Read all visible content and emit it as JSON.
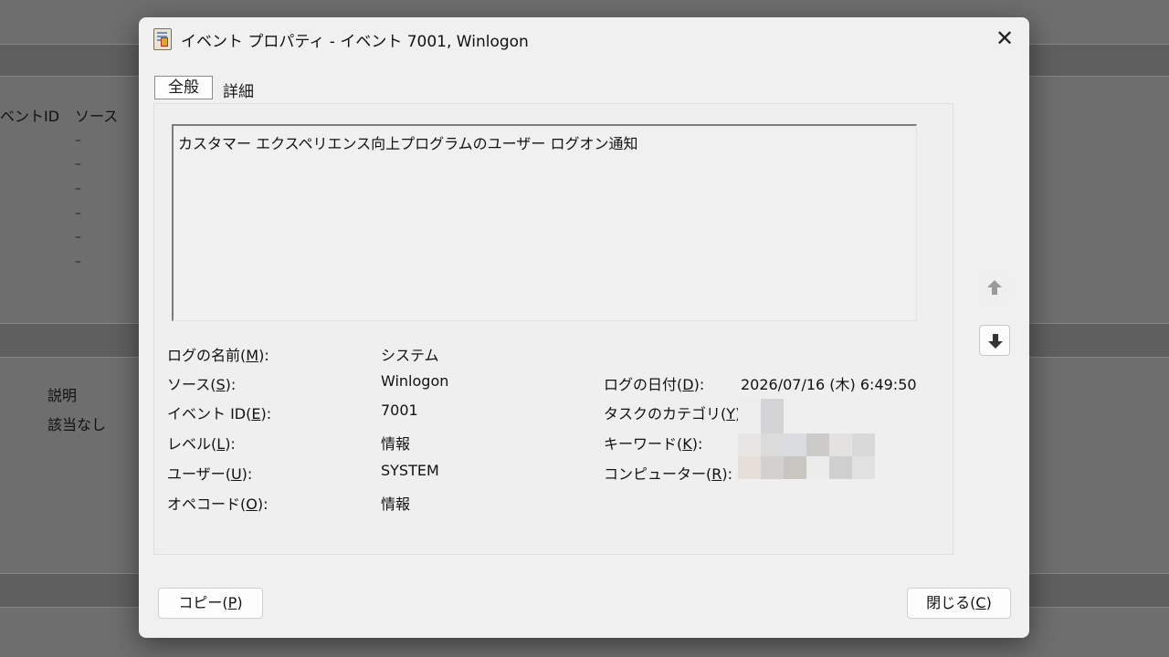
{
  "background": {
    "col_event_id": "ベントID",
    "col_source": "ソース",
    "row_placeholder": "–",
    "desc_label": "説明",
    "desc_value": "該当なし"
  },
  "dialog": {
    "title": "イベント プロパティ - イベント 7001, Winlogon",
    "close_glyph": "✕",
    "tabs": [
      "全般",
      "詳細"
    ],
    "description": "カスタマー エクスペリエンス向上プログラムのユーザー ログオン通知",
    "fields": {
      "log_name": {
        "label": "ログの名前",
        "key": "M",
        "value": "システム"
      },
      "source": {
        "label": "ソース",
        "key": "S",
        "value": "Winlogon"
      },
      "event_id": {
        "label": "イベント ID",
        "key": "E",
        "value": "7001"
      },
      "level": {
        "label": "レベル",
        "key": "L",
        "value": "情報"
      },
      "user": {
        "label": "ユーザー",
        "key": "U",
        "value": "SYSTEM"
      },
      "opcode": {
        "label": "オペコード",
        "key": "O",
        "value": "情報"
      },
      "logged": {
        "label": "ログの日付",
        "key": "D",
        "value": "2026/07/16 (木) 6:49:50"
      },
      "task_category": {
        "label": "タスクのカテゴリ",
        "key": "Y",
        "value": ""
      },
      "keywords": {
        "label": "キーワード",
        "key": "K",
        "value": ""
      },
      "computer": {
        "label": "コンピューター",
        "key": "R",
        "value": ""
      }
    },
    "buttons": {
      "copy": {
        "label": "コピー",
        "key": "P"
      },
      "close": {
        "label": "閉じる",
        "key": "C"
      }
    },
    "icons": {
      "scroll_up": "arrow-up-icon",
      "scroll_down": "arrow-down-icon",
      "title": "event-properties-icon"
    }
  }
}
